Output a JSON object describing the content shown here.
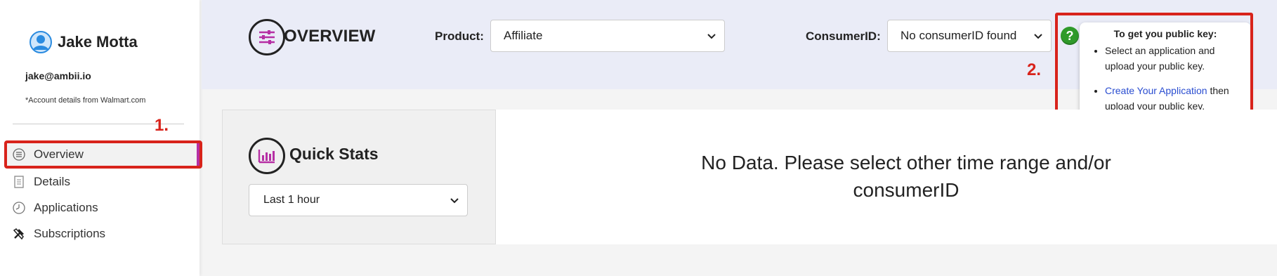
{
  "user": {
    "name": "Jake Motta",
    "email": "jake@ambii.io",
    "account_note": "*Account details from Walmart.com"
  },
  "annotations": {
    "step1": "1.",
    "step2": "2."
  },
  "sidebar": {
    "items": [
      {
        "label": "Overview",
        "icon": "list-circle-icon",
        "active": true
      },
      {
        "label": "Details",
        "icon": "document-icon",
        "active": false
      },
      {
        "label": "Applications",
        "icon": "clock-icon",
        "active": false
      },
      {
        "label": "Subscriptions",
        "icon": "tools-icon",
        "active": false
      }
    ]
  },
  "header": {
    "title": "OVERVIEW",
    "icon": "sliders-icon",
    "product_label": "Product:",
    "product_value": "Affiliate",
    "consumer_label": "ConsumerID:",
    "consumer_value": "No consumerID found"
  },
  "help": {
    "title": "To get you public key:",
    "bullet1": "Select an application and upload your public key.",
    "link_text": "Create Your Application",
    "bullet2_rest": "then upload your public key."
  },
  "main": {
    "stats_title": "Quick Stats",
    "stats_icon": "bar-chart-icon",
    "time_range": "Last 1 hour",
    "no_data_line1": "No Data. Please select other time range and/or",
    "no_data_line2": "consumerID"
  },
  "colors": {
    "accent": "#b62fa4",
    "annotation_red": "#d8231b",
    "header_bg": "#eaecf7",
    "help_green": "#2f9a2a",
    "link_blue": "#2a4dd0"
  }
}
